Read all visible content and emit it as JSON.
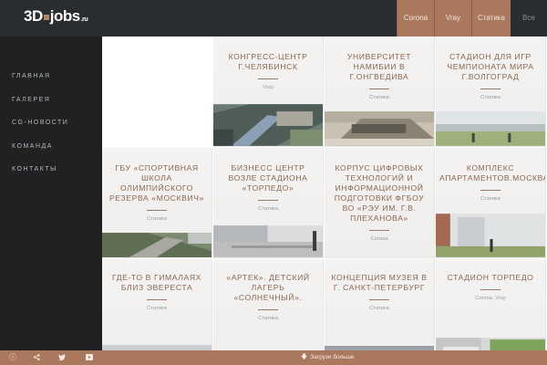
{
  "brand": {
    "logo_main": "3D",
    "logo_tail": "jobs",
    "logo_suffix": ".ru"
  },
  "filters": [
    {
      "label": "Corona"
    },
    {
      "label": "Vray"
    },
    {
      "label": "Статика"
    },
    {
      "label": "Все"
    }
  ],
  "nav": [
    {
      "label": "Главная"
    },
    {
      "label": "Галерея"
    },
    {
      "label": "CG-новости"
    },
    {
      "label": "Команда"
    },
    {
      "label": "Контакты"
    }
  ],
  "tiles": [
    {
      "title": "Конгресс-центр г.Челябинск",
      "category": "Vray"
    },
    {
      "title": "Университет Намибии в г.Онгведива",
      "category": "Статика"
    },
    {
      "title": "Стадион для игр чемпионата мира г.Волгоград",
      "category": "Статика"
    },
    {
      "title": "ГБУ «Спортивная школа олимпийского резерва «Москвич»",
      "category": "Статика"
    },
    {
      "title": "Бизнесс центр возле стадиона «Торпедо»",
      "category": "Статика"
    },
    {
      "title": "Корпус цифровых технологий и информационной подготовки ФГБОУ ВО «РЭУ им. Г.В. Плеханова»",
      "category": "Corona"
    },
    {
      "title": "Комплекс апартаментов.Москва",
      "category": "Статика"
    },
    {
      "title": "Где-то в Гималаях близ Эвереста",
      "category": "Статика"
    },
    {
      "title": "«Артек». Детский лагерь «Солнечный».",
      "category": "Статика"
    },
    {
      "title": "Концепция музея в г. Санкт-Петербург",
      "category": "Статика"
    },
    {
      "title": "Стадион Торпедо",
      "category": "Corona ,Vray"
    }
  ],
  "footer": {
    "load_more": "Загрузи больше",
    "icons": [
      "info-icon",
      "share-icon",
      "twitter-icon",
      "video-icon"
    ]
  }
}
